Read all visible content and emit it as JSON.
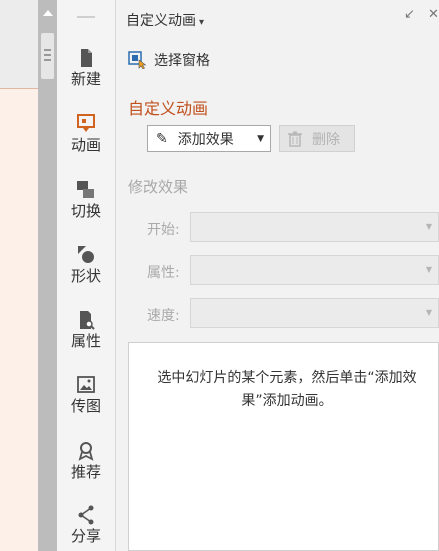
{
  "sidebar": {
    "items": [
      {
        "label": "新建",
        "icon": "new-doc-icon"
      },
      {
        "label": "动画",
        "icon": "animation-icon"
      },
      {
        "label": "切换",
        "icon": "transition-icon"
      },
      {
        "label": "形状",
        "icon": "shape-icon"
      },
      {
        "label": "属性",
        "icon": "property-icon"
      },
      {
        "label": "传图",
        "icon": "upload-image-icon"
      },
      {
        "label": "推荐",
        "icon": "recommend-icon"
      },
      {
        "label": "分享",
        "icon": "share-icon"
      }
    ],
    "active": "动画"
  },
  "pane": {
    "title": "自定义动画",
    "title_caret": "▾",
    "restore_glyph": "↙",
    "close_glyph": "✕",
    "selection_pane": "选择窗格",
    "section_title": "自定义动画",
    "add_effect": "添加效果",
    "delete": "删除",
    "modify_title": "修改效果",
    "fields": {
      "start": "开始:",
      "property": "属性:",
      "speed": "速度:"
    },
    "hint": "选中幻灯片的某个元素，然后单击“添加效果”添加动画。"
  },
  "colors": {
    "accent": "#c0501c",
    "active_icon": "#d0631f",
    "icon_gray": "#555555"
  }
}
